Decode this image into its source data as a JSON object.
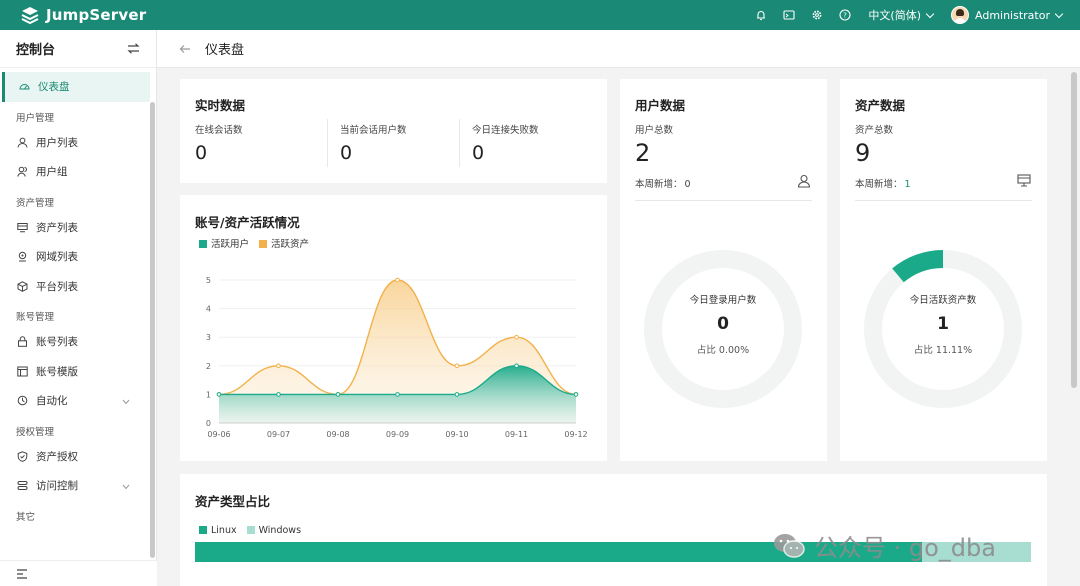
{
  "topbar": {
    "brand": "JumpServer",
    "language": "中文(简体)",
    "username": "Administrator",
    "icons": [
      "bell-icon",
      "terminal-icon",
      "gear-icon",
      "help-icon"
    ],
    "background_color": "#1a8a76"
  },
  "sidebar": {
    "title": "控制台",
    "items": [
      {
        "type": "item",
        "label": "仪表盘",
        "icon": "dashboard-icon",
        "active": true
      },
      {
        "type": "group",
        "label": "用户管理"
      },
      {
        "type": "item",
        "label": "用户列表",
        "icon": "user-icon"
      },
      {
        "type": "item",
        "label": "用户组",
        "icon": "users-icon"
      },
      {
        "type": "group",
        "label": "资产管理"
      },
      {
        "type": "item",
        "label": "资产列表",
        "icon": "monitor-icon"
      },
      {
        "type": "item",
        "label": "网域列表",
        "icon": "location-icon"
      },
      {
        "type": "item",
        "label": "平台列表",
        "icon": "cube-icon"
      },
      {
        "type": "group",
        "label": "账号管理"
      },
      {
        "type": "item",
        "label": "账号列表",
        "icon": "lock-icon"
      },
      {
        "type": "item",
        "label": "账号模版",
        "icon": "template-icon"
      },
      {
        "type": "item",
        "label": "自动化",
        "icon": "automation-icon",
        "expandable": true
      },
      {
        "type": "group",
        "label": "授权管理"
      },
      {
        "type": "item",
        "label": "资产授权",
        "icon": "shield-icon"
      },
      {
        "type": "item",
        "label": "访问控制",
        "icon": "access-icon",
        "expandable": true
      },
      {
        "type": "group",
        "label": "其它"
      }
    ]
  },
  "breadcrumb": {
    "title": "仪表盘"
  },
  "realtime": {
    "title": "实时数据",
    "stats": [
      {
        "label": "在线会话数",
        "value": "0"
      },
      {
        "label": "当前会话用户数",
        "value": "0"
      },
      {
        "label": "今日连接失败数",
        "value": "0"
      }
    ]
  },
  "activity": {
    "title": "账号/资产活跃情况",
    "legend": [
      {
        "label": "活跃用户",
        "color": "#1aaa8a"
      },
      {
        "label": "活跃资产",
        "color": "#f2b14a"
      }
    ]
  },
  "user_data": {
    "title": "用户数据",
    "total_label": "用户总数",
    "total_value": "2",
    "weekly_label": "本周新增：",
    "weekly_value": "0",
    "ring_label": "今日登录用户数",
    "ring_value": "0",
    "ring_ratio": "占比 0.00%",
    "ring_fraction": 0.0
  },
  "asset_data": {
    "title": "资产数据",
    "total_label": "资产总数",
    "total_value": "9",
    "weekly_label": "本周新增：",
    "weekly_value": "1",
    "ring_label": "今日活跃资产数",
    "ring_value": "1",
    "ring_ratio": "占比 11.11%",
    "ring_fraction": 0.1111
  },
  "asset_types": {
    "title": "资产类型占比",
    "legend": [
      {
        "label": "Linux",
        "color": "#1aaa8a",
        "fraction": 0.87
      },
      {
        "label": "Windows",
        "color": "#a8ddd2",
        "fraction": 0.13
      }
    ]
  },
  "watermark": "公众号 · go_dba",
  "chart_data": {
    "type": "area",
    "title": "账号/资产活跃情况",
    "categories": [
      "09-06",
      "09-07",
      "09-08",
      "09-09",
      "09-10",
      "09-11",
      "09-12"
    ],
    "series": [
      {
        "name": "活跃用户",
        "values": [
          1,
          1,
          1,
          1,
          1,
          2,
          1
        ],
        "color": "#1aaa8a"
      },
      {
        "name": "活跃资产",
        "values": [
          1,
          2,
          1,
          5,
          2,
          3,
          1
        ],
        "color": "#f2b14a"
      }
    ],
    "yticks": [
      "0",
      "1",
      "2",
      "3",
      "4",
      "5"
    ],
    "ylim": [
      0,
      5
    ],
    "grid": true,
    "legend": "top-left"
  }
}
